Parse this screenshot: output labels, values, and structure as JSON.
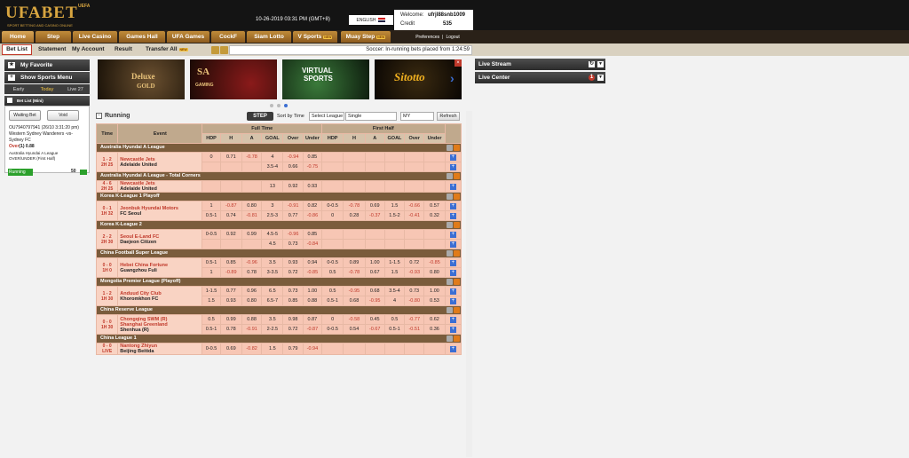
{
  "header": {
    "brand": "UFABET",
    "brand_super": "UEFA",
    "tagline": "SPORT BETTING AND CASINO ONLINE",
    "datetime": "10-26-2019 03:31 PM (GMT+8)",
    "language": "ENGLISH",
    "welcome_label": "Welcome:",
    "username": "ufrjl88snb1009",
    "credit_label": "Credit",
    "credit_value": "535",
    "preferences": "Preferences",
    "logout": "Logout"
  },
  "nav": {
    "tabs": [
      {
        "label": "Home"
      },
      {
        "label": "Step"
      },
      {
        "label": "Live Casino"
      },
      {
        "label": "Games Hall"
      },
      {
        "label": "UFA Games"
      },
      {
        "label": "CockF"
      },
      {
        "label": "Siam Lotto"
      },
      {
        "label": "V Sports"
      },
      {
        "label": "Muay Step"
      }
    ],
    "new_badge": "NEW"
  },
  "subnav": {
    "items": [
      "Bet List",
      "Statement",
      "My Account",
      "Result",
      "Transfer All"
    ],
    "ticker": "Soccer: In-running bets placed from 1:24:59"
  },
  "left": {
    "my_favorite": "My Favorite",
    "show_sports_menu": "Show Sports Menu",
    "tabs": [
      "Early",
      "Today",
      "Live 27"
    ],
    "bet_list_mini": "Bet List (Mini)",
    "waiting_bet": "Waiting Bet",
    "void": "Void",
    "bet": {
      "ref": "OU7940797941 (26/10 3:31:20 pm)",
      "match": "Western Sydney Wanderers -vs-",
      "match2": "Sydney FC",
      "selection": "Over",
      "handicap": "(1)",
      "odds": "0.88",
      "league": "Australia Hyundai A League",
      "market": "OVER/UNDER (First Half)",
      "status": "Running",
      "stake": "50"
    }
  },
  "banners": [
    {
      "title": "Deluxe",
      "sub": "GOLD"
    },
    {
      "title": "SA",
      "sub": "GAMING"
    },
    {
      "title": "VIRTUAL",
      "sub": "SPORTS"
    },
    {
      "title": "Sitotto",
      "sub": ""
    }
  ],
  "main": {
    "title": "Running",
    "step": "STEP",
    "sort_by_time": "Sort by Time",
    "select_league": "Select League",
    "single": "Single",
    "my": "MY",
    "refresh": "Refresh",
    "headers": {
      "time": "Time",
      "event": "Event",
      "full_time": "Full Time",
      "first_half": "First Half",
      "hdp": "HDP",
      "h": "H",
      "a": "A",
      "goal": "GOAL",
      "over": "Over",
      "under": "Under"
    },
    "leagues": [
      {
        "name": "Australia Hyundai A League",
        "matches": [
          {
            "score": "1 - 2",
            "time": "2H 25",
            "home": "Newcastle Jets",
            "away": "Adelaide United",
            "lines": [
              [
                "0",
                "0.71",
                "-0.78",
                "4",
                "-0.94",
                "0.85",
                "",
                "",
                "",
                "",
                "",
                ""
              ],
              [
                "",
                "",
                "",
                "3.5-4",
                "0.66",
                "-0.75",
                "",
                "",
                "",
                "",
                "",
                ""
              ]
            ]
          }
        ]
      },
      {
        "name": "Australia Hyundai A League - Total Corners",
        "matches": [
          {
            "score": "4 - 6",
            "time": "2H 25",
            "home": "Newcastle Jets",
            "away": "Adelaide United",
            "lines": [
              [
                "",
                "",
                "",
                "13",
                "0.92",
                "0.93",
                "",
                "",
                "",
                "",
                "",
                ""
              ]
            ]
          }
        ]
      },
      {
        "name": "Korea K-League 1 Playoff",
        "matches": [
          {
            "score": "0 - 1",
            "time": "1H 32",
            "home": "Jeonbuk Hyundai Motors",
            "away": "FC Seoul",
            "lines": [
              [
                "1",
                "-0.87",
                "0.80",
                "3",
                "-0.91",
                "0.82",
                "0-0.5",
                "-0.78",
                "0.69",
                "1.5",
                "-0.66",
                "0.57"
              ],
              [
                "0.5-1",
                "0.74",
                "-0.81",
                "2.5-3",
                "0.77",
                "-0.86",
                "0",
                "0.28",
                "-0.37",
                "1.5-2",
                "-0.41",
                "0.32"
              ]
            ]
          }
        ]
      },
      {
        "name": "Korea K-League 2",
        "matches": [
          {
            "score": "2 - 2",
            "time": "2H 30",
            "home": "Seoul E-Land FC",
            "away": "Daejeon Citizen",
            "lines": [
              [
                "0-0.5",
                "0.92",
                "0.99",
                "4.5-5",
                "-0.96",
                "0.85",
                "",
                "",
                "",
                "",
                "",
                ""
              ],
              [
                "",
                "",
                "",
                "4.5",
                "0.73",
                "-0.84",
                "",
                "",
                "",
                "",
                "",
                ""
              ]
            ]
          }
        ]
      },
      {
        "name": "China Football Super League",
        "matches": [
          {
            "score": "0 - 0",
            "time": "1H 0",
            "home": "Hebei China Fortune",
            "away": "Guangzhou Fuli",
            "lines": [
              [
                "0.5-1",
                "0.85",
                "-0.96",
                "3.5",
                "0.93",
                "0.94",
                "0-0.5",
                "0.89",
                "1.00",
                "1-1.5",
                "0.72",
                "-0.85"
              ],
              [
                "1",
                "-0.89",
                "0.78",
                "3-3.5",
                "0.72",
                "-0.85",
                "0.5",
                "-0.78",
                "0.67",
                "1.5",
                "-0.93",
                "0.80"
              ]
            ]
          }
        ]
      },
      {
        "name": "Mongolia Premier League (Playoff)",
        "matches": [
          {
            "score": "1 - 2",
            "time": "1H 30",
            "home": "Anduud City Club",
            "away": "Khoromkhon FC",
            "lines": [
              [
                "1-1.5",
                "0.77",
                "0.96",
                "6.5",
                "0.73",
                "1.00",
                "0.5",
                "-0.95",
                "0.68",
                "3.5-4",
                "0.73",
                "1.00"
              ],
              [
                "1.5",
                "0.93",
                "0.80",
                "6.5-7",
                "0.85",
                "0.88",
                "0.5-1",
                "0.68",
                "-0.95",
                "4",
                "-0.80",
                "0.53"
              ]
            ]
          }
        ]
      },
      {
        "name": "China Reserve League",
        "matches": [
          {
            "score": "0 - 0",
            "time": "1H 30",
            "home": "Chongqing SWM (R)",
            "home2": "Shanghai Greenland",
            "away": "Shenhua (R)",
            "lines": [
              [
                "0.5",
                "0.99",
                "0.88",
                "3.5",
                "0.98",
                "0.87",
                "0",
                "-0.58",
                "0.45",
                "0.5",
                "-0.77",
                "0.62"
              ],
              [
                "0.5-1",
                "0.78",
                "-0.91",
                "2-2.5",
                "0.72",
                "-0.87",
                "0-0.5",
                "0.54",
                "-0.67",
                "0.5-1",
                "-0.51",
                "0.36"
              ]
            ]
          }
        ]
      },
      {
        "name": "China League 1",
        "matches": [
          {
            "score": "0 - 0",
            "time": "LIVE",
            "home": "Nantong Zhiyun",
            "away": "Beijing Beitida",
            "lines": [
              [
                "0-0.5",
                "0.69",
                "-0.82",
                "1.5",
                "0.79",
                "-0.94",
                "",
                "",
                "",
                "",
                "",
                ""
              ]
            ]
          }
        ]
      }
    ]
  },
  "right": {
    "live_stream": "Live Stream",
    "live_center": "Live Center",
    "live_center_badge": "1"
  }
}
